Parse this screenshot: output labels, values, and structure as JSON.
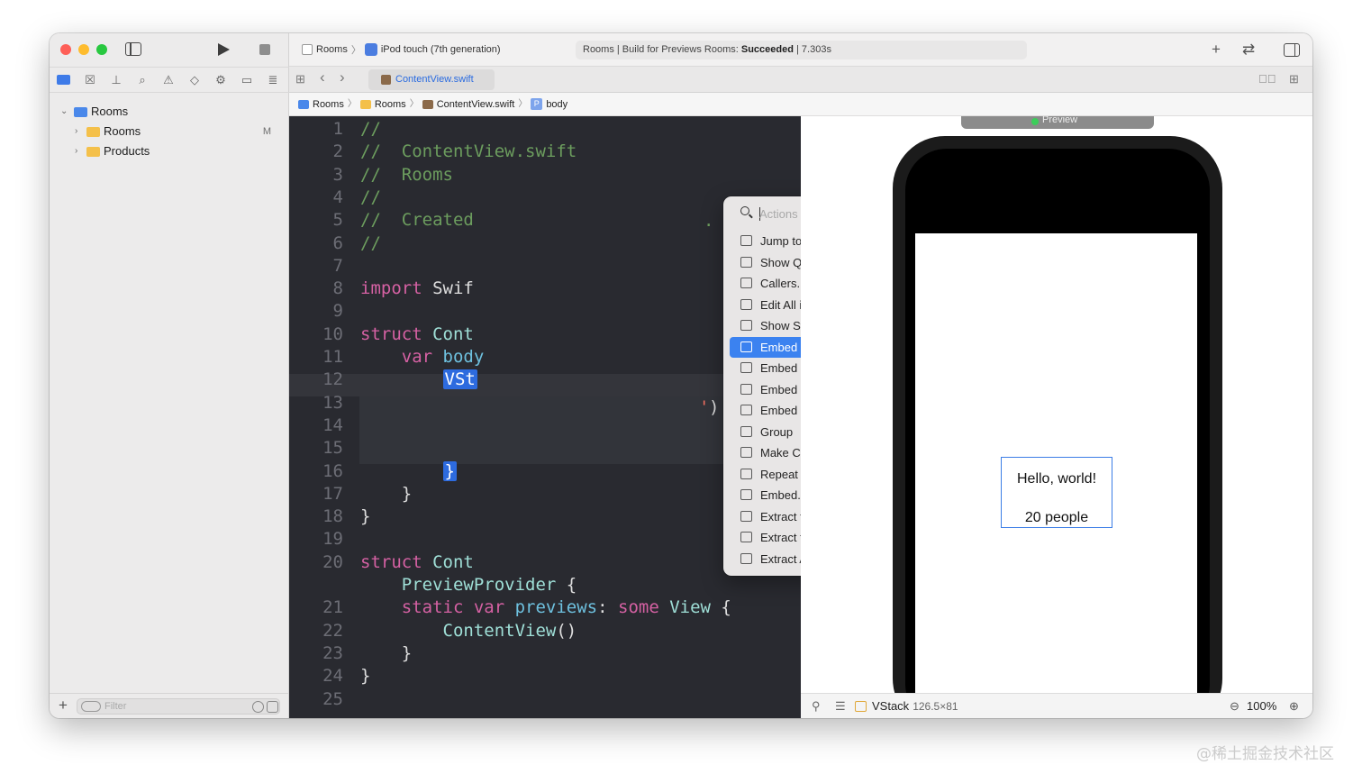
{
  "sidebar": {
    "tree": [
      {
        "label": "Rooms",
        "chevron": "⌄",
        "badge": ""
      },
      {
        "label": "Rooms",
        "chevron": "›",
        "badge": "M"
      },
      {
        "label": "Products",
        "chevron": "›",
        "badge": ""
      }
    ],
    "filter_placeholder": "Filter"
  },
  "toolbar": {
    "scheme_project": "Rooms",
    "scheme_sep": "〉",
    "scheme_device": "iPod touch (7th generation)",
    "activity_prefix": "Rooms | Build for Previews Rooms: ",
    "activity_status": "Succeeded",
    "activity_time": " | 7.303s",
    "plus": "+",
    "swap": "⇄"
  },
  "tabs": {
    "grid": "⊞",
    "back": "‹",
    "forward": "›",
    "active_tab": "ContentView.swift",
    "right1": "≣⃞",
    "right2": "⊞"
  },
  "breadcrumb": {
    "items": [
      "Rooms",
      "Rooms",
      "ContentView.swift",
      "body"
    ],
    "sep": "〉",
    "p_badge": "P"
  },
  "editor": {
    "lines": [
      {
        "n": "1",
        "tokens": [
          {
            "t": "//",
            "c": "c-com"
          }
        ]
      },
      {
        "n": "2",
        "tokens": [
          {
            "t": "//  ContentView.swift",
            "c": "c-com"
          }
        ]
      },
      {
        "n": "3",
        "tokens": [
          {
            "t": "//  Rooms",
            "c": "c-com"
          }
        ]
      },
      {
        "n": "4",
        "tokens": [
          {
            "t": "//",
            "c": "c-com"
          }
        ]
      },
      {
        "n": "5",
        "tokens": [
          {
            "t": "//  Created",
            "c": "c-com"
          }
        ]
      },
      {
        "n": "6",
        "tokens": [
          {
            "t": "//",
            "c": "c-com"
          }
        ]
      },
      {
        "n": "7",
        "tokens": []
      },
      {
        "n": "8",
        "tokens": [
          {
            "t": "import ",
            "c": "c-kw"
          },
          {
            "t": "Swif",
            "c": "c-plain"
          }
        ]
      },
      {
        "n": "9",
        "tokens": []
      },
      {
        "n": "10",
        "tokens": [
          {
            "t": "struct ",
            "c": "c-kw"
          },
          {
            "t": "Cont",
            "c": "c-type"
          }
        ]
      },
      {
        "n": "11",
        "tokens": [
          {
            "t": "    ",
            "c": "c-plain"
          },
          {
            "t": "var ",
            "c": "c-kw"
          },
          {
            "t": "body",
            "c": "c-prop"
          }
        ]
      },
      {
        "n": "12",
        "tokens": [
          {
            "t": "        ",
            "c": "c-plain"
          },
          {
            "t": "VSt",
            "c": "sel"
          }
        ]
      },
      {
        "n": "13",
        "tokens": []
      },
      {
        "n": "14",
        "tokens": []
      },
      {
        "n": "15",
        "tokens": []
      },
      {
        "n": "16",
        "tokens": [
          {
            "t": "        ",
            "c": "c-plain"
          },
          {
            "t": "}",
            "c": "sel"
          }
        ]
      },
      {
        "n": "17",
        "tokens": [
          {
            "t": "    }",
            "c": "c-plain"
          }
        ]
      },
      {
        "n": "18",
        "tokens": [
          {
            "t": "}",
            "c": "c-plain"
          }
        ]
      },
      {
        "n": "19",
        "tokens": []
      },
      {
        "n": "20",
        "tokens": [
          {
            "t": "struct ",
            "c": "c-kw"
          },
          {
            "t": "Cont",
            "c": "c-type"
          }
        ]
      },
      {
        "n": "",
        "tokens": [
          {
            "t": "    ",
            "c": "c-plain"
          },
          {
            "t": "PreviewProvider",
            "c": "c-type"
          },
          {
            "t": " {",
            "c": "c-plain"
          }
        ]
      },
      {
        "n": "21",
        "tokens": [
          {
            "t": "    ",
            "c": "c-plain"
          },
          {
            "t": "static var ",
            "c": "c-kw"
          },
          {
            "t": "previews",
            "c": "c-prop"
          },
          {
            "t": ": ",
            "c": "c-plain"
          },
          {
            "t": "some ",
            "c": "c-kw"
          },
          {
            "t": "View",
            "c": "c-type"
          },
          {
            "t": " {",
            "c": "c-plain"
          }
        ]
      },
      {
        "n": "22",
        "tokens": [
          {
            "t": "        ",
            "c": "c-plain"
          },
          {
            "t": "ContentView",
            "c": "c-type"
          },
          {
            "t": "()",
            "c": "c-plain"
          }
        ]
      },
      {
        "n": "23",
        "tokens": [
          {
            "t": "    }",
            "c": "c-plain"
          }
        ]
      },
      {
        "n": "24",
        "tokens": [
          {
            "t": "}",
            "c": "c-plain"
          }
        ]
      },
      {
        "n": "25",
        "tokens": []
      }
    ],
    "overflow_right": [
      {
        "text": ".",
        "cls": "c-com"
      },
      {
        "text": ")",
        "cls": "c-plain"
      },
      {
        "text": "'",
        "cls": "c-str"
      }
    ]
  },
  "menu": {
    "search_placeholder": "Actions",
    "items": [
      {
        "label": "Jump to Definition",
        "shortcut": "^⌘",
        "active": false
      },
      {
        "label": "Show Quick Help",
        "shortcut": "⌥",
        "active": false
      },
      {
        "label": "Callers...",
        "shortcut": "",
        "active": false
      },
      {
        "label": "Edit All in Scope",
        "shortcut": "",
        "active": false
      },
      {
        "label": "Show SwiftUI Inspector...",
        "shortcut": "^⌥",
        "active": false
      },
      {
        "label": "Embed in HStack",
        "shortcut": "",
        "active": true
      },
      {
        "label": "Embed in VStack",
        "shortcut": "",
        "active": false
      },
      {
        "label": "Embed in ZStack",
        "shortcut": "",
        "active": false
      },
      {
        "label": "Embed in List",
        "shortcut": "",
        "active": false
      },
      {
        "label": "Group",
        "shortcut": "",
        "active": false
      },
      {
        "label": "Make Conditional",
        "shortcut": "",
        "active": false
      },
      {
        "label": "Repeat",
        "shortcut": "",
        "active": false
      },
      {
        "label": "Embed...",
        "shortcut": "",
        "active": false
      },
      {
        "label": "Extract to Variable",
        "shortcut": "",
        "active": false
      },
      {
        "label": "Extract to Method",
        "shortcut": "",
        "active": false
      },
      {
        "label": "Extract All Occurrences",
        "shortcut": "",
        "active": false
      }
    ]
  },
  "preview": {
    "toolbar_label": "Preview",
    "hello": "Hello, world!",
    "people": "20 people",
    "selected_view": "VStack",
    "selected_dims": "126.5×81",
    "zoom": "100%",
    "pin": "⚲",
    "adjust": "☰",
    "zoom_out": "⊖",
    "zoom_in": "⊕"
  },
  "watermark": "@稀土掘金技术社区",
  "colors": {
    "accent": "#3b82f0",
    "editor_bg": "#292a30",
    "comment": "#6c9d5e",
    "keyword": "#d561a3"
  }
}
